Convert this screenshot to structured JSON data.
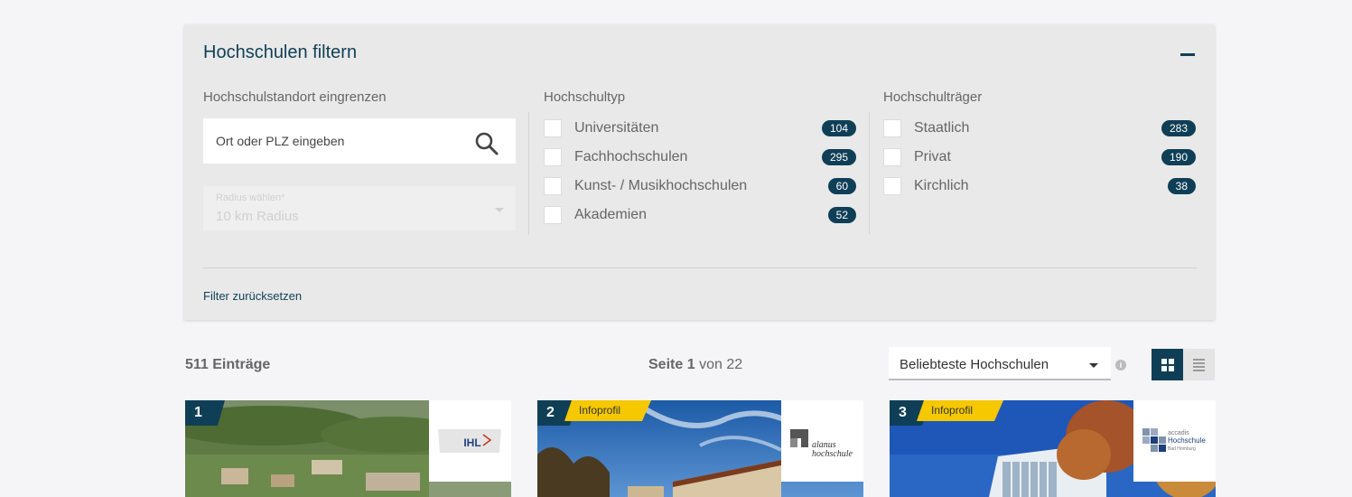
{
  "filter": {
    "title": "Hochschulen filtern",
    "location": {
      "heading": "Hochschulstandort eingrenzen",
      "placeholder": "Ort oder PLZ eingeben",
      "radius_label": "Radius wählen*",
      "radius_value": "10 km Radius"
    },
    "type": {
      "heading": "Hochschultyp",
      "options": [
        {
          "label": "Universitäten",
          "count": "104"
        },
        {
          "label": "Fachhochschulen",
          "count": "295"
        },
        {
          "label": "Kunst- / Musikhochschulen",
          "count": "60"
        },
        {
          "label": "Akademien",
          "count": "52"
        }
      ]
    },
    "carrier": {
      "heading": "Hochschulträger",
      "options": [
        {
          "label": "Staatlich",
          "count": "283"
        },
        {
          "label": "Privat",
          "count": "190"
        },
        {
          "label": "Kirchlich",
          "count": "38"
        }
      ]
    },
    "reset_label": "Filter zurücksetzen"
  },
  "results": {
    "count_label": "511 Einträge",
    "page_prefix": "Seite",
    "page_current": "1",
    "page_sep": "von",
    "page_total": "22",
    "sort_label": "Beliebteste Hochschulen",
    "info_glyph": "i"
  },
  "cards": [
    {
      "rank": "1",
      "logo_text": "IHL"
    },
    {
      "rank": "2",
      "badge": "Infoprofil",
      "logo_text_1": "alanus",
      "logo_text_2": "hochschule"
    },
    {
      "rank": "3",
      "badge": "Infoprofil",
      "logo_text_1": "accadis",
      "logo_text_2": "Hochschule",
      "logo_text_3": "Bad Homburg"
    }
  ],
  "colors": {
    "accent": "#0f3f56",
    "badge_yellow": "#f5c800",
    "panel_bg": "#e9e9e9",
    "page_bg": "#f5f5f7"
  }
}
